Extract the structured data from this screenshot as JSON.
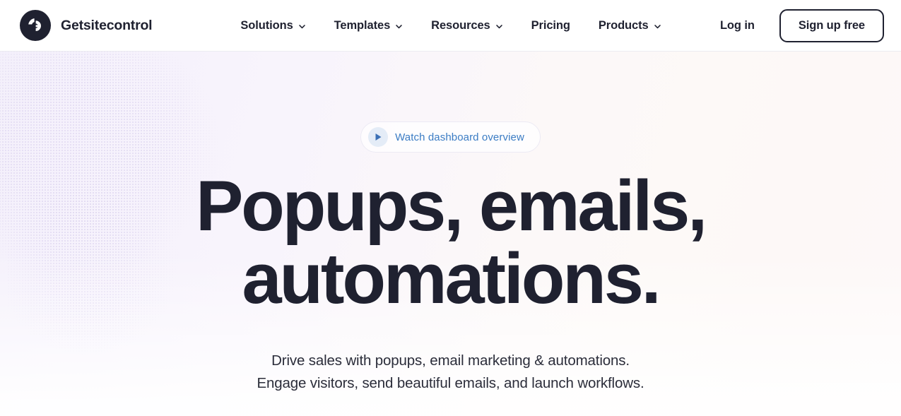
{
  "header": {
    "brand": {
      "name": "Getsitecontrol",
      "logo_icon": "getsitecontrol-logo-icon",
      "logo_bg": "#1f2130"
    },
    "nav_items": [
      {
        "label": "Solutions",
        "has_dropdown": true
      },
      {
        "label": "Templates",
        "has_dropdown": true
      },
      {
        "label": "Resources",
        "has_dropdown": true
      },
      {
        "label": "Pricing",
        "has_dropdown": false
      },
      {
        "label": "Products",
        "has_dropdown": true
      }
    ],
    "login_label": "Log in",
    "signup_label": "Sign up free"
  },
  "hero": {
    "watch_button": {
      "label": "Watch dashboard overview",
      "icon": "play-icon",
      "text_color": "#3b7cc4",
      "icon_bg": "#e4ecf7"
    },
    "headline_lines": [
      "Popups, emails,",
      "automations."
    ],
    "headline_color": "#1f2130",
    "subtitle_lines": [
      "Drive sales with popups, email marketing & automations.",
      "Engage visitors, send beautiful emails, and launch workflows."
    ],
    "background": {
      "gradient_from": "#f4f0fb",
      "gradient_to": "#fdf8f8"
    }
  }
}
